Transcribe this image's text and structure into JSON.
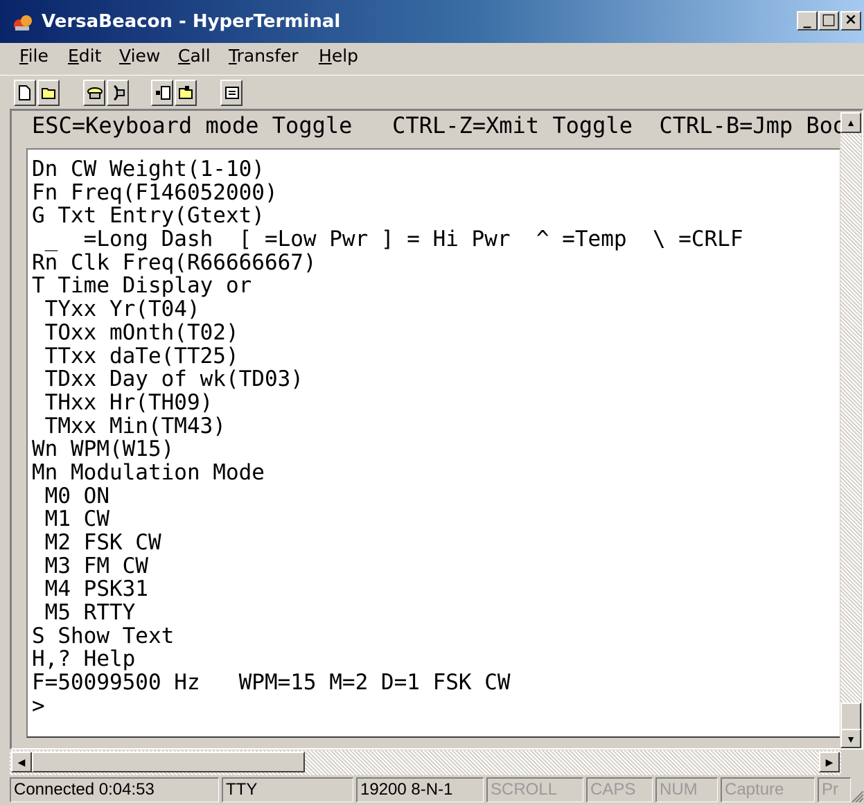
{
  "window": {
    "title": "VersaBeacon - HyperTerminal",
    "controls": {
      "minimize": "_",
      "maximize": "□",
      "close": "×"
    }
  },
  "menu": [
    {
      "label": "File",
      "accel": "F",
      "rest": "ile"
    },
    {
      "label": "Edit",
      "accel": "E",
      "rest": "dit"
    },
    {
      "label": "View",
      "accel": "V",
      "rest": "iew"
    },
    {
      "label": "Call",
      "accel": "C",
      "rest": "all"
    },
    {
      "label": "Transfer",
      "accel": "T",
      "rest": "ransfer"
    },
    {
      "label": "Help",
      "accel": "H",
      "rest": "elp"
    }
  ],
  "toolbar": {
    "icons": [
      "new-connection-icon",
      "open-icon",
      "connect-phone-icon",
      "disconnect-phone-icon",
      "send-icon",
      "receive-icon",
      "properties-icon"
    ]
  },
  "terminal": {
    "header": "ESC=Keyboard mode Toggle   CTRL-Z=Xmit Toggle  CTRL-B=Jmp Boot",
    "lines": [
      "Dn CW Weight(1-10)",
      "Fn Freq(F146052000)",
      "G Txt Entry(Gtext)",
      " _  =Long Dash  [ =Low Pwr ] = Hi Pwr  ^ =Temp  \\ =CRLF",
      "Rn Clk Freq(R66666667)",
      "T Time Display or",
      " TYxx Yr(T04)",
      " TOxx mOnth(T02)",
      " TTxx daTe(TT25)",
      " TDxx Day of wk(TD03)",
      " THxx Hr(TH09)",
      " TMxx Min(TM43)",
      "Wn WPM(W15)",
      "Mn Modulation Mode",
      " M0 ON",
      " M1 CW",
      " M2 FSK CW",
      " M3 FM CW",
      " M4 PSK31",
      " M5 RTTY",
      "S Show Text",
      "H,? Help",
      "F=50099500 Hz   WPM=15 M=2 D=1 FSK CW",
      ">"
    ]
  },
  "statusbar": {
    "connected": "Connected 0:04:53",
    "emulation": "TTY",
    "port": "19200 8-N-1",
    "scroll": "SCROLL",
    "caps": "CAPS",
    "num": "NUM",
    "capture": "Capture",
    "print": "Pr"
  }
}
